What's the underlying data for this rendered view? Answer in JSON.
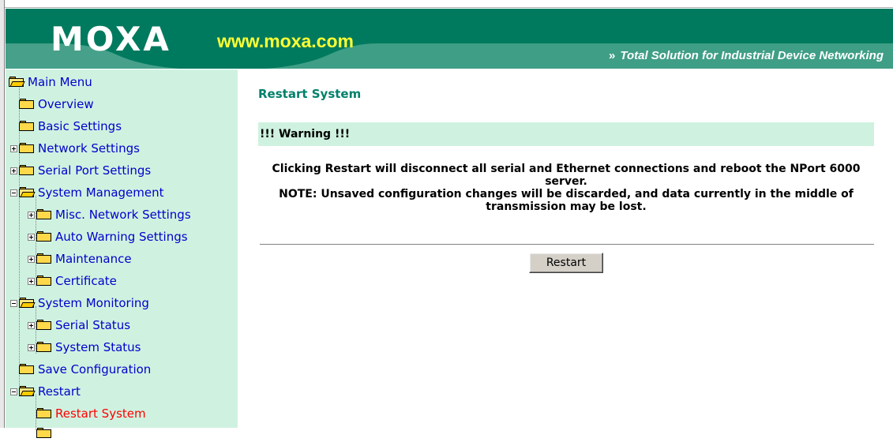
{
  "header": {
    "logo": "MOXA",
    "url": "www.moxa.com",
    "tagline_arrows": "»",
    "tagline": "Total Solution for Industrial Device Networking",
    "brand_color": "#00806a",
    "url_color": "#ffff33"
  },
  "sidebar": {
    "items": [
      {
        "label": "Main Menu",
        "expander": "none",
        "folder": "open"
      },
      {
        "label": "Overview",
        "expander": "none",
        "folder": "closed"
      },
      {
        "label": "Basic Settings",
        "expander": "none",
        "folder": "closed"
      },
      {
        "label": "Network Settings",
        "expander": "plus",
        "folder": "closed"
      },
      {
        "label": "Serial Port Settings",
        "expander": "plus",
        "folder": "closed"
      },
      {
        "label": "System Management",
        "expander": "minus",
        "folder": "open"
      },
      {
        "label": "Misc. Network Settings",
        "expander": "plus",
        "folder": "closed"
      },
      {
        "label": "Auto Warning Settings",
        "expander": "plus",
        "folder": "closed"
      },
      {
        "label": "Maintenance",
        "expander": "plus",
        "folder": "closed"
      },
      {
        "label": "Certificate",
        "expander": "plus",
        "folder": "closed"
      },
      {
        "label": "System Monitoring",
        "expander": "minus",
        "folder": "open"
      },
      {
        "label": "Serial Status",
        "expander": "plus",
        "folder": "closed"
      },
      {
        "label": "System Status",
        "expander": "plus",
        "folder": "closed"
      },
      {
        "label": "Save Configuration",
        "expander": "none",
        "folder": "closed"
      },
      {
        "label": "Restart",
        "expander": "minus",
        "folder": "open"
      },
      {
        "label": "Restart System",
        "expander": "none",
        "folder": "closed",
        "active": true
      }
    ]
  },
  "main": {
    "title": "Restart System",
    "warning": "!!! Warning !!!",
    "message_line1": "Clicking Restart will disconnect all serial and Ethernet connections and reboot the NPort 6000 server.",
    "message_line2": "NOTE: Unsaved configuration changes will be discarded, and data currently in the middle of transmission may be lost.",
    "restart_label": "Restart"
  }
}
